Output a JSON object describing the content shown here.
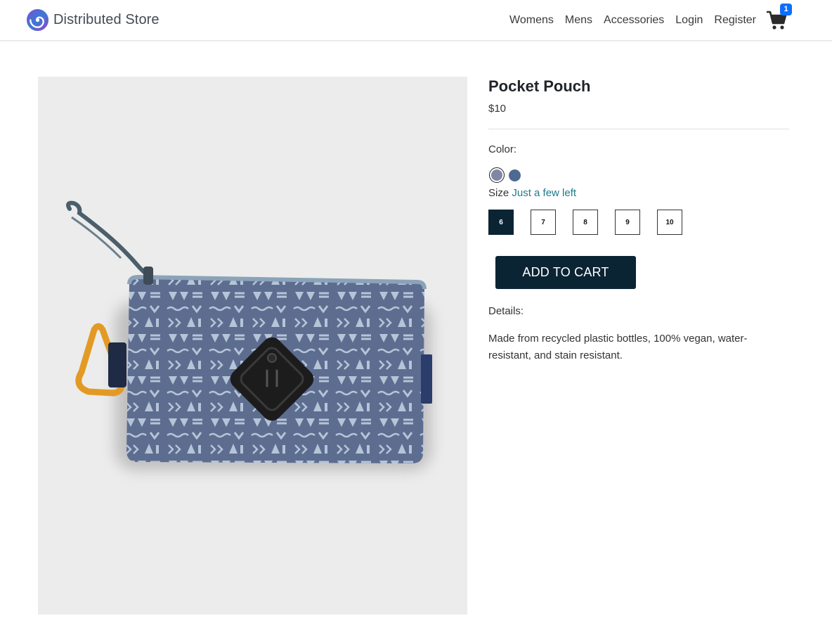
{
  "brand": {
    "name": "Distributed Store",
    "logo_icon": "spiral-logo-icon"
  },
  "nav": {
    "links": [
      "Womens",
      "Mens",
      "Accessories",
      "Login",
      "Register"
    ],
    "cart": {
      "icon": "shopping-cart-icon",
      "count": "1",
      "badge_color": "#0d6efd"
    }
  },
  "product": {
    "image_alt": "Pocket Pouch",
    "title": "Pocket Pouch",
    "price": "$10",
    "color_label": "Color:",
    "colors": [
      "#7f86a6",
      "#4d6a93"
    ],
    "selected_color_index": 0,
    "size_label": "Size",
    "stock_note": "Just a few left",
    "sizes": [
      "6",
      "7",
      "8",
      "9",
      "10"
    ],
    "selected_size": "6",
    "add_to_cart": "ADD TO CART",
    "details_label": "Details:",
    "details_text": "Made from recycled plastic bottles, 100% vegan, water-resistant, and stain resistant."
  },
  "colors": {
    "primary_dark": "#0b2434",
    "accent": "#1f7a8c"
  }
}
